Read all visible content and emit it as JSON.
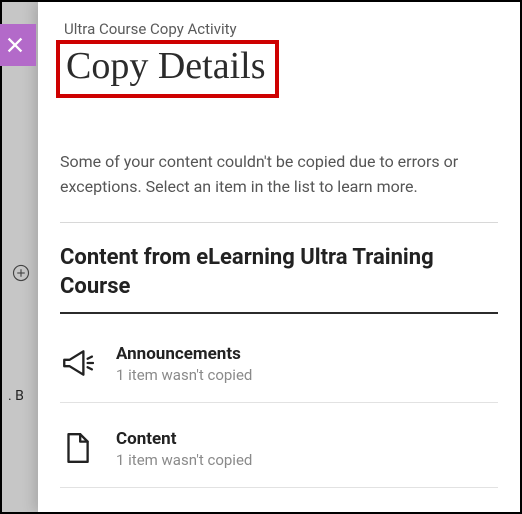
{
  "header": {
    "breadcrumb": "Ultra Course Copy Activity",
    "title": "Copy Details"
  },
  "description": "Some of your content couldn't be copied due to errors or exceptions. Select an item in the list to learn more.",
  "section": {
    "heading": "Content from eLearning Ultra Training Course"
  },
  "items": [
    {
      "title": "Announcements",
      "subtitle": "1 item wasn't copied"
    },
    {
      "title": "Content",
      "subtitle": "1 item wasn't copied"
    }
  ],
  "background": {
    "fragment": ". B"
  }
}
